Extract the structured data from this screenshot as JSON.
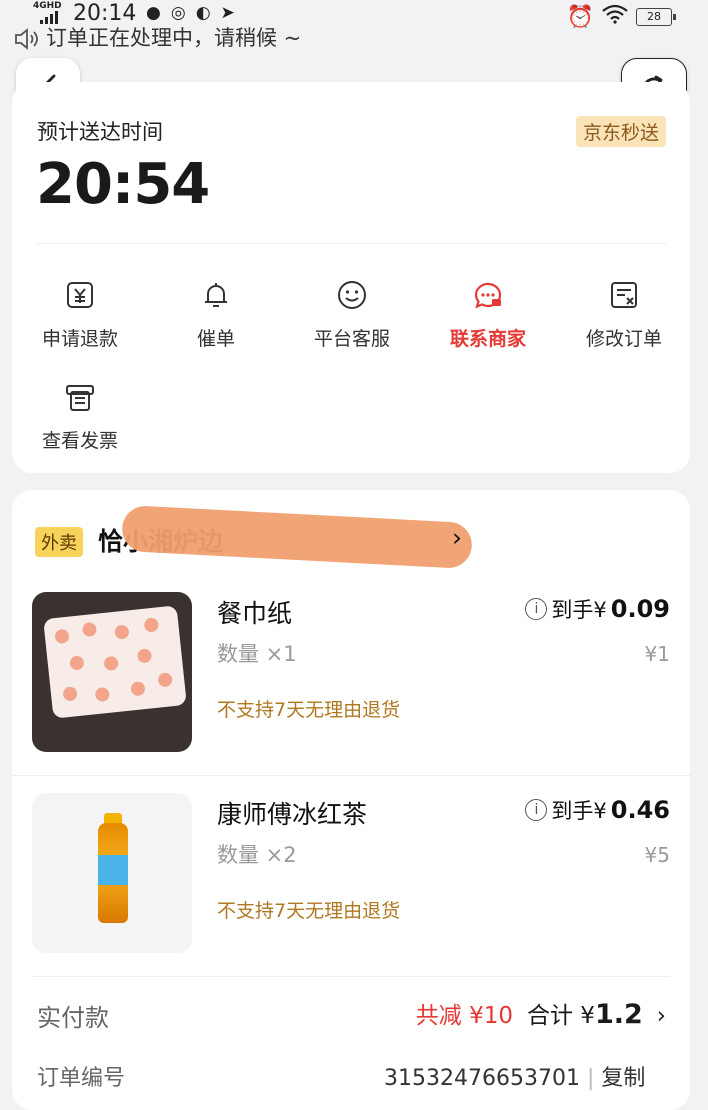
{
  "status_bar": {
    "network": "4GHD",
    "time": "20:14",
    "battery": "28"
  },
  "notice": {
    "text": "订单正在处理中，请稍候 ~"
  },
  "delivery": {
    "eta_label": "预计送达时间",
    "eta_time": "20:54",
    "service_badge": "京东秒送"
  },
  "actions": [
    {
      "label": "申请退款",
      "icon": "refund-icon"
    },
    {
      "label": "催单",
      "icon": "bell-icon"
    },
    {
      "label": "平台客服",
      "icon": "service-smile-icon"
    },
    {
      "label": "联系商家",
      "icon": "merchant-chat-icon",
      "highlight": true
    },
    {
      "label": "修改订单",
      "icon": "edit-order-icon"
    },
    {
      "label": "查看发票",
      "icon": "invoice-icon"
    }
  ],
  "shop": {
    "tag": "外卖",
    "name": "恰小湘炉边"
  },
  "items": [
    {
      "name": "餐巾纸",
      "quantity": "数量 ×1",
      "notice": "不支持7天无理由退货",
      "price_prefix": "到手¥",
      "price": "0.09",
      "original_price": "¥1"
    },
    {
      "name": "康师傅冰红茶",
      "quantity": "数量 ×2",
      "notice": "不支持7天无理由退货",
      "price_prefix": "到手¥",
      "price": "0.46",
      "original_price": "¥5"
    }
  ],
  "payment": {
    "label": "实付款",
    "discount": "共减 ¥10",
    "total_prefix": "合计 ¥",
    "total": "1.2"
  },
  "order": {
    "label": "订单编号",
    "number": "31532476653701",
    "copy": "复制"
  },
  "colors": {
    "accent_red": "#e53935",
    "badge_bg": "#fbe3b8",
    "takeaway_tag": "#f7d35b",
    "warning_text": "#b07820"
  }
}
